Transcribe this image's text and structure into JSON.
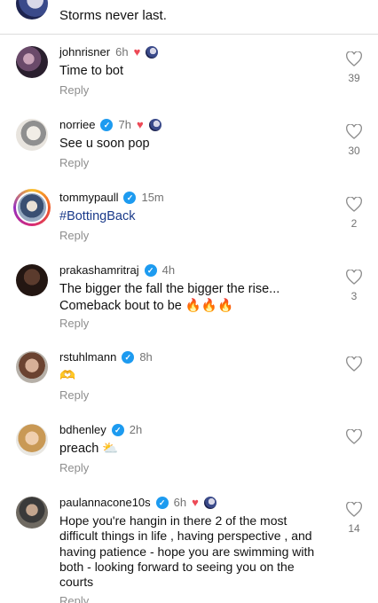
{
  "top_comment": {
    "text": "Storms never last."
  },
  "comments": [
    {
      "username": "johnrisner",
      "time": "6h",
      "text": "Time to bot",
      "reply": "Reply",
      "likes": "39"
    },
    {
      "username": "norriee",
      "time": "7h",
      "text": "See u soon pop",
      "reply": "Reply",
      "likes": "30"
    },
    {
      "username": "tommypaull",
      "time": "15m",
      "text": "#BottingBack",
      "reply": "Reply",
      "likes": "2"
    },
    {
      "username": "prakashamritraj",
      "time": "4h",
      "text": "The bigger the fall the bigger the rise... Comeback bout to be 🔥🔥🔥",
      "reply": "Reply",
      "likes": "3"
    },
    {
      "username": "rstuhlmann",
      "time": "8h",
      "text": "🫶",
      "reply": "Reply",
      "likes": ""
    },
    {
      "username": "bdhenley",
      "time": "2h",
      "text": "preach ⛅",
      "reply": "Reply",
      "likes": ""
    },
    {
      "username": "paulannacone10s",
      "time": "6h",
      "text": "Hope you're hangin in there 2 of the most difficult things in life , having perspective , and having patience - hope you are swimming with both - looking forward to seeing you on the courts",
      "reply": "Reply",
      "likes": "14"
    }
  ],
  "icons": {
    "heart": "heart-outline-icon",
    "verified": "verified-badge-icon",
    "creator_liked": "red-heart-icon"
  },
  "colors": {
    "verified": "#1d9bf0",
    "liked_heart": "#ed4956",
    "hashtag": "#1a3a8a",
    "secondary_text": "#737373"
  }
}
